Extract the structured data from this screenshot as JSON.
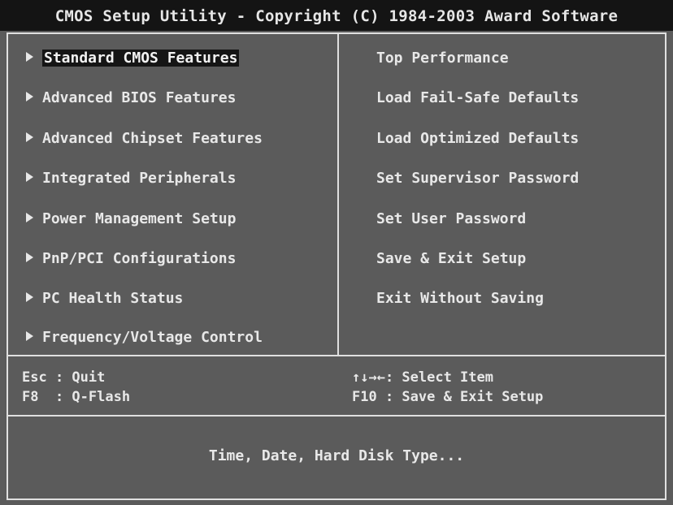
{
  "title": "CMOS Setup Utility - Copyright (C) 1984-2003 Award Software",
  "left_menu": [
    {
      "label": "Standard CMOS Features",
      "selected": true
    },
    {
      "label": "Advanced BIOS Features"
    },
    {
      "label": "Advanced Chipset Features"
    },
    {
      "label": "Integrated Peripherals"
    },
    {
      "label": "Power Management Setup"
    },
    {
      "label": "PnP/PCI Configurations"
    },
    {
      "label": "PC Health Status"
    },
    {
      "label": "Frequency/Voltage Control"
    }
  ],
  "right_menu": [
    {
      "label": "Top Performance"
    },
    {
      "label": "Load Fail-Safe Defaults"
    },
    {
      "label": "Load Optimized Defaults"
    },
    {
      "label": "Set Supervisor Password"
    },
    {
      "label": "Set User Password"
    },
    {
      "label": "Save & Exit Setup"
    },
    {
      "label": "Exit Without Saving"
    }
  ],
  "hints": {
    "esc": "Esc : Quit",
    "f8": "F8  : Q-Flash",
    "arrows": "↑↓→←: Select Item",
    "f10": "F10 : Save & Exit Setup"
  },
  "description": "Time, Date, Hard Disk Type...",
  "colors": {
    "background": "#5b5b5b",
    "title_bar": "#141414",
    "text": "#e8e8e8",
    "highlight": "#151515"
  }
}
